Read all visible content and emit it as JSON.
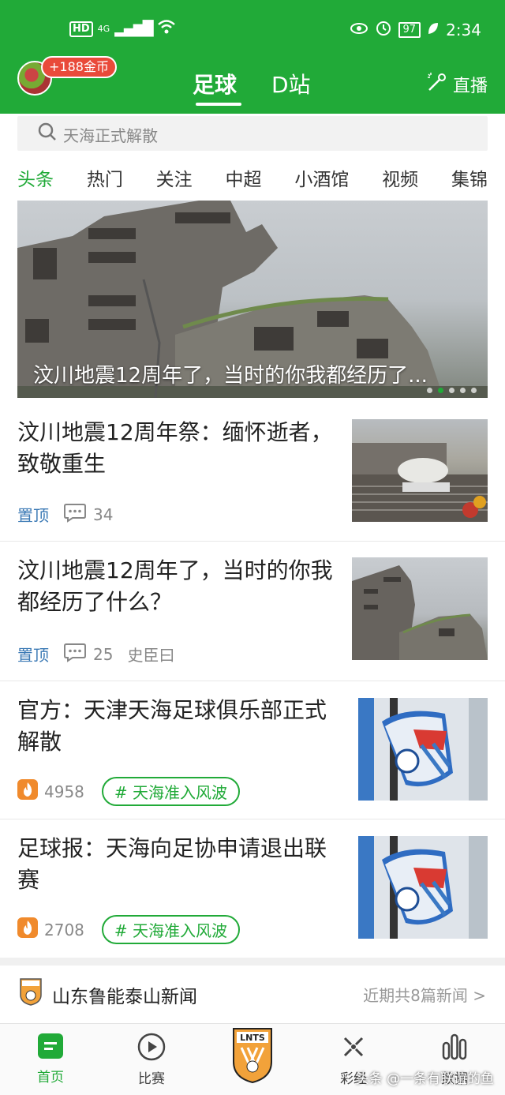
{
  "status_bar": {
    "network_badge": "HD",
    "network_type": "4G",
    "battery": "97",
    "time": "2:34"
  },
  "top_nav": {
    "coins_badge": "+188金币",
    "tabs": [
      {
        "label": "足球",
        "active": true
      },
      {
        "label": "D站",
        "active": false
      }
    ],
    "live_label": "直播"
  },
  "search": {
    "placeholder": "天海正式解散"
  },
  "categories": [
    "头条",
    "热门",
    "关注",
    "中超",
    "小酒馆",
    "视频",
    "集锦"
  ],
  "active_category": "头条",
  "hero": {
    "caption": "汶川地震12周年了，当时的你我都经历了...",
    "slide_count": 5,
    "active_slide": 2
  },
  "news": [
    {
      "title": "汶川地震12周年祭：缅怀逝者，致敬重生",
      "pinned_label": "置顶",
      "comments": "34",
      "author": ""
    },
    {
      "title": "汶川地震12周年了，当时的你我都经历了什么？",
      "pinned_label": "置顶",
      "comments": "25",
      "author": "史臣曰"
    },
    {
      "title": "官方：天津天海足球俱乐部正式解散",
      "heat": "4958",
      "tag": "# 天海准入风波"
    },
    {
      "title": "足球报：天海向足协申请退出联赛",
      "heat": "2708",
      "tag": "# 天海准入风波"
    }
  ],
  "club_news": {
    "name": "山东鲁能泰山新闻",
    "more": "近期共8篇新闻 >"
  },
  "bottom_nav": [
    {
      "label": "首页",
      "icon": "home-icon",
      "active": true
    },
    {
      "label": "比赛",
      "icon": "play-icon",
      "active": false
    },
    {
      "label": "",
      "icon": "club-logo",
      "active": false
    },
    {
      "label": "彩经",
      "icon": "lottery-icon",
      "active": false
    },
    {
      "label": "数据",
      "icon": "data-icon",
      "active": false
    }
  ],
  "watermark": "头条 @一条有联谊的鱼",
  "colors": {
    "brand": "#21aa38",
    "badge": "#e94a3a",
    "pin": "#3c7ab5",
    "heat": "#f08a2c"
  }
}
